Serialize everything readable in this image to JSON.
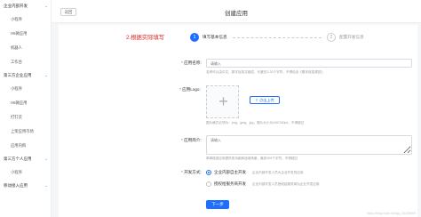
{
  "sidebar": {
    "entries": [
      {
        "type": "group",
        "label": "企业内部开发"
      },
      {
        "type": "item",
        "label": "小程序"
      },
      {
        "type": "item",
        "label": "H5微应用"
      },
      {
        "type": "item",
        "label": "机器人"
      },
      {
        "type": "item",
        "label": "工作台"
      },
      {
        "type": "group",
        "label": "第三方企业应用"
      },
      {
        "type": "item",
        "label": "小程序"
      },
      {
        "type": "item",
        "label": "H5微应用"
      },
      {
        "type": "item",
        "label": "打钉云"
      },
      {
        "type": "item",
        "label": "上架应用市场"
      },
      {
        "type": "item",
        "label": "应用内购"
      },
      {
        "type": "group",
        "label": "第三方个人应用"
      },
      {
        "type": "item",
        "label": "小程序"
      },
      {
        "type": "group",
        "label": "移动接入应用"
      }
    ]
  },
  "header": {
    "back_label": "返回",
    "title": "创建应用"
  },
  "annotation": "2.根据实际填写",
  "steps": [
    {
      "number": "1",
      "label": "填写基本信息",
      "active": true
    },
    {
      "number": "2",
      "label": "配置开发信息",
      "active": false
    }
  ],
  "form": {
    "app_name": {
      "label": "应用名称:",
      "required_mark": "*",
      "placeholder": "请输入",
      "hint": "名称可以由中文、数字及英文组成，长度在2-20个字符，不得包含《基本信息规范》"
    },
    "app_logo": {
      "label": "应用Logo:",
      "required_mark": "*",
      "upload_label": "点击上传",
      "plus": "+",
      "hint": "图片格式必须为：png、jpeg、jpg，图片大小为240*240px，不得超过"
    },
    "app_desc": {
      "label": "应用简介:",
      "required_mark": "*",
      "placeholder": "请输入",
      "hint": "简单描述应用提供的功能和适用场景，最多200个字符，不得超过"
    },
    "dev_mode": {
      "label": "开发方式:",
      "required_mark": "*",
      "options": [
        {
          "label": "企业内部自主开发",
          "desc": "企业内部开发人员为企业开发的应用",
          "checked": true
        },
        {
          "label": "授权给服务商开发",
          "desc": "企业内部开发人员授权给服务商为企业开发应用",
          "checked": false
        }
      ]
    },
    "next_label": "下一步"
  },
  "watermark": "https://blog.csdn.net/qq_33185969",
  "colors": {
    "accent": "#1e6fff",
    "required": "#e0241c",
    "annotation": "#e0241c"
  }
}
